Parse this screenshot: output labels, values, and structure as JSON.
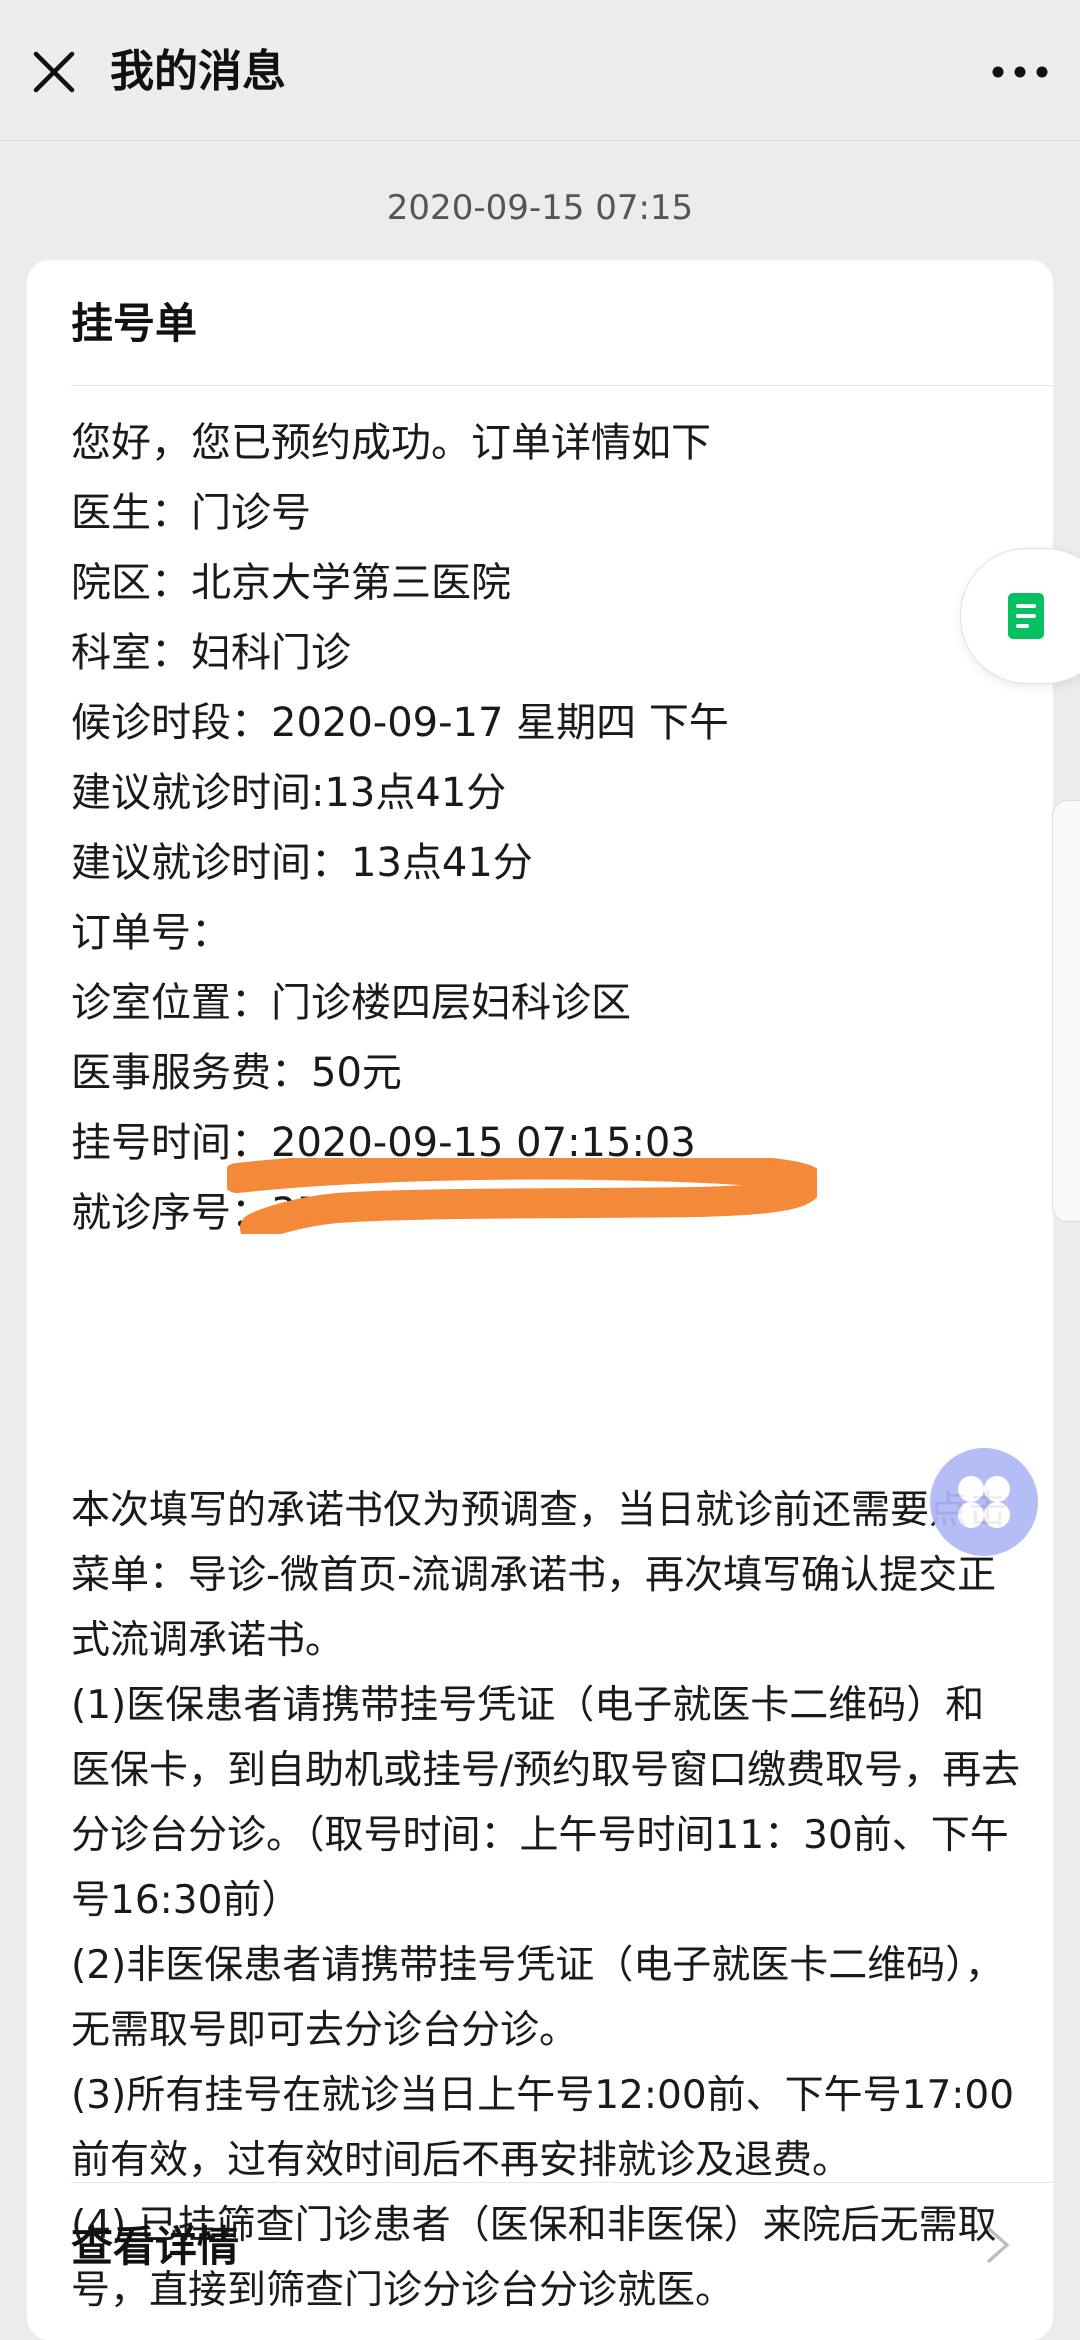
{
  "header": {
    "title": "我的消息",
    "close_icon": "close-icon",
    "more_icon": "more-dots-icon"
  },
  "message": {
    "timestamp": "2020-09-15 07:15",
    "card_title": "挂号单",
    "lines": [
      "您好，您已预约成功。订单详情如下",
      "医生：门诊号",
      "院区：北京大学第三医院",
      "科室：妇科门诊",
      "候诊时段：2020-09-17 星期四 下午",
      "建议就诊时间:13点41分",
      "建议就诊时间：13点41分",
      "订单号：",
      "诊室位置：门诊楼四层妇科诊区",
      "医事服务费：50元",
      "挂号时间：2020-09-15 07:15:03",
      "就诊序号：35"
    ],
    "notes": [
      "本次填写的承诺书仅为预调查，当日就诊前还需要点击菜单：导诊-微首页-流调承诺书，再次填写确认提交正式流调承诺书。",
      "(1)医保患者请携带挂号凭证（电子就医卡二维码）和医保卡，到自助机或挂号/预约取号窗口缴费取号，再去分诊台分诊。（取号时间：上午号时间11：30前、下午号16:30前）",
      "(2)非医保患者请携带挂号凭证（电子就医卡二维码），无需取号即可去分诊台分诊。",
      "(3)所有挂号在就诊当日上午号12:00前、下午号17:00前有效，过有效时间后不再安排就诊及退费。",
      "(4) 已挂筛查门诊患者（医保和非医保）来院后无需取号，直接到筛查门诊分诊台分诊就医。"
    ],
    "details_label": "查看详情"
  },
  "colors": {
    "header_bg": "#ededed",
    "page_bg": "#ececec",
    "card_bg": "#ffffff",
    "redaction": "#f5893a",
    "float_doc_icon": "#07c160",
    "float_menu": "#aeb8f5"
  }
}
